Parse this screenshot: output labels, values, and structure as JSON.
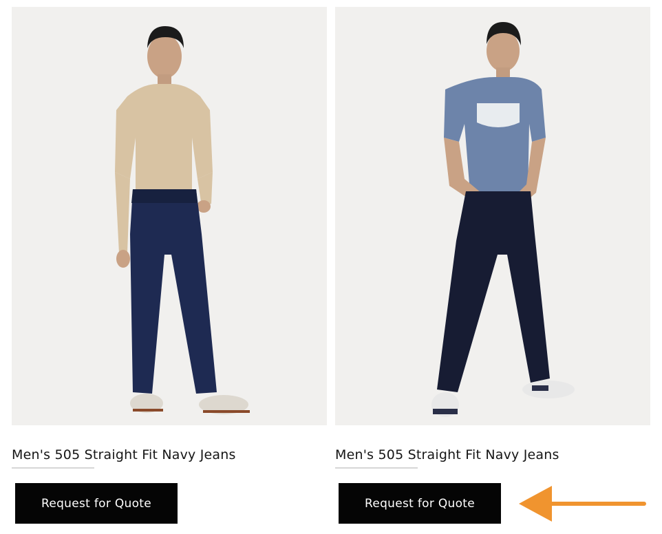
{
  "products": [
    {
      "title": "Men's 505 Straight Fit Navy Jeans",
      "button_label": "Request for Quote",
      "image_desc": "model in beige henley and dark navy jeans"
    },
    {
      "title": "Men's 505 Straight Fit Navy Jeans",
      "button_label": "Request for Quote",
      "image_desc": "model in blue logo t-shirt and navy jeans"
    }
  ],
  "colors": {
    "button_bg": "#050505",
    "button_text": "#ffffff",
    "arrow": "#f0942f",
    "photo_bg": "#f1f0ee"
  }
}
